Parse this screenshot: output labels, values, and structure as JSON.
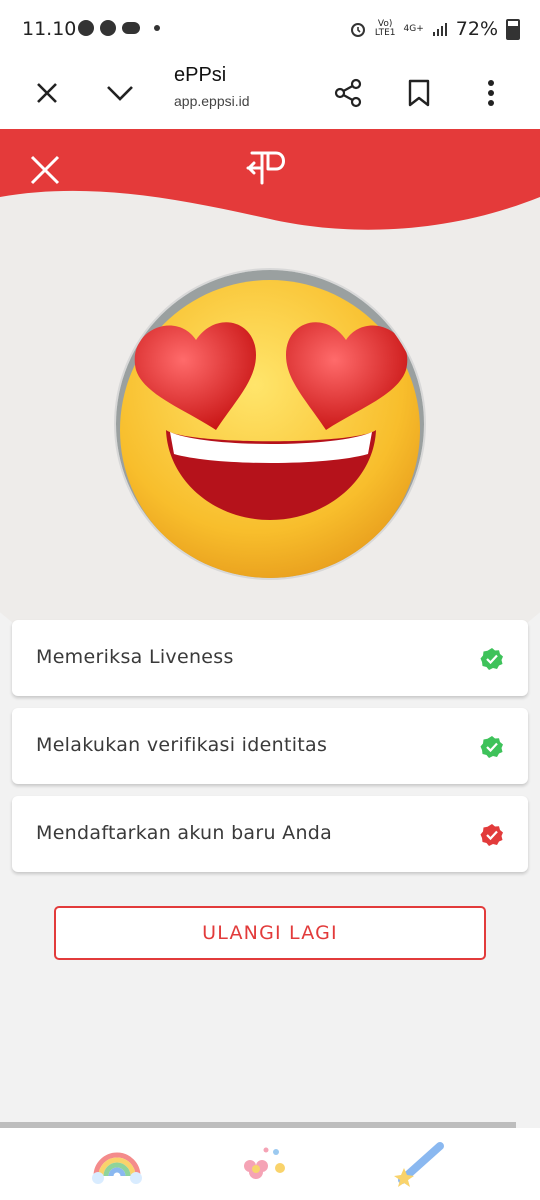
{
  "status_bar": {
    "time": "11.10",
    "network_top": "Vo)",
    "network_bottom": "LTE1",
    "signal_label": "4G+",
    "battery": "72%"
  },
  "browser": {
    "title": "ePPsi",
    "url": "app.eppsi.id"
  },
  "steps": [
    {
      "label": "Memeriksa Liveness",
      "status": "success",
      "color": "#3ec25a"
    },
    {
      "label": "Melakukan verifikasi identitas",
      "status": "success",
      "color": "#3ec25a"
    },
    {
      "label": "Mendaftarkan akun baru Anda",
      "status": "failed",
      "color": "#e23b3b"
    }
  ],
  "retry_label": "ULANGI LAGI",
  "colors": {
    "brand_red": "#e23b3b",
    "success_green": "#3ec25a"
  },
  "icons": [
    "close-icon",
    "chevron-down-icon",
    "share-icon",
    "bookmark-icon",
    "more-vert-icon",
    "eppsi-logo",
    "rainbow-icon",
    "flowers-icon",
    "shooting-star-icon"
  ]
}
